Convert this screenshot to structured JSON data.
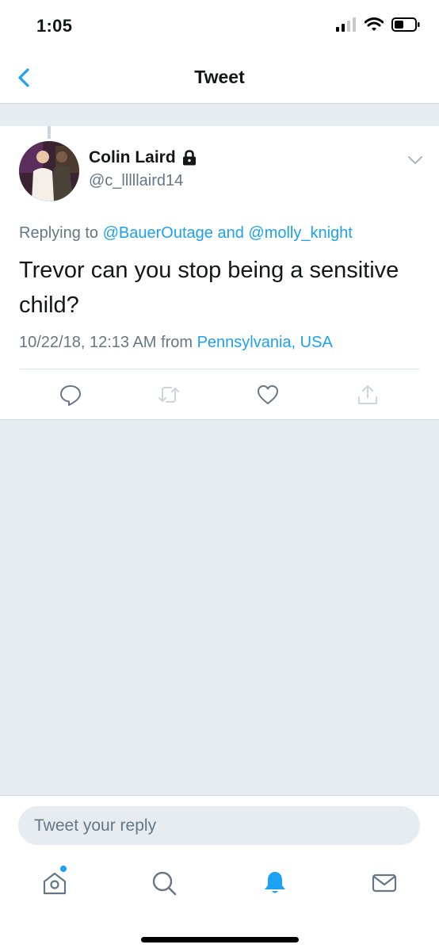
{
  "status": {
    "time": "1:05"
  },
  "nav": {
    "title": "Tweet"
  },
  "tweet": {
    "name": "Colin Laird",
    "handle": "@c_lllllaird14",
    "replying_prefix": "Replying to ",
    "replying_user1": "@BauerOutage",
    "replying_and": " and ",
    "replying_user2": "@molly_knight",
    "text": "Trevor can you stop being a sensitive child?",
    "timestamp": "10/22/18, 12:13 AM from ",
    "location": "Pennsylvania, USA"
  },
  "icons": {
    "back": "chevron-left-icon",
    "lock": "lock-icon",
    "more": "chevron-down-icon",
    "reply": "reply-icon",
    "retweet": "retweet-icon",
    "like": "heart-icon",
    "share": "share-icon",
    "home": "home-icon",
    "search": "search-icon",
    "notifications": "bell-icon",
    "messages": "mail-icon"
  },
  "reply": {
    "placeholder": "Tweet your reply"
  },
  "colors": {
    "accent": "#1da1f2",
    "secondary_text": "#657786",
    "background": "#e6ecf0"
  }
}
